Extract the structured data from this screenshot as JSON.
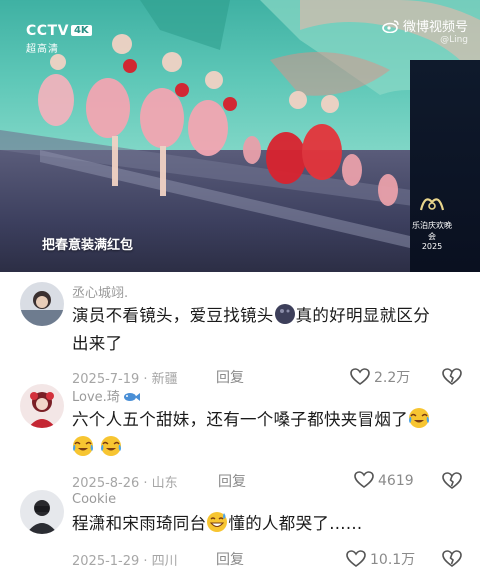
{
  "video": {
    "channel_logo": "CCTV",
    "channel_badge": "4K",
    "channel_sub": "超高清",
    "watermark": "微博视频号",
    "watermark_sub": "@Ling",
    "caption": "把春意装满红包",
    "gala_logo_text": "乐泊庆欢晚会",
    "gala_year": "2025"
  },
  "comments": [
    {
      "username": "丞心城翊.",
      "text_line1_a": "演员不看镜头，爱豆找镜头",
      "text_line1_b": "真的好明显就区分",
      "text_line2": "出来了",
      "date_location": "2025-7-19 · 新疆",
      "reply_label": "回复",
      "likes": "2.2万"
    },
    {
      "username": "Love.琦",
      "text_line1": "六个人五个甜妹，还有一个嗓子都快夹冒烟了",
      "date_location": "2025-8-26 · 山东",
      "reply_label": "回复",
      "likes": "4619"
    },
    {
      "username": "Cookie",
      "text_line1_a": "程潇和宋雨琦同台",
      "text_line1_b": "懂的人都哭了......",
      "date_location": "2025-1-29 · 四川",
      "reply_label": "回复",
      "likes": "10.1万"
    }
  ],
  "icons": [
    "weibo-logo-icon",
    "heart-icon",
    "broken-heart-icon",
    "dark-orb-emoji-icon",
    "crying-laughing-emoji-icon",
    "grin-sweat-emoji-icon",
    "fish-icon"
  ],
  "colors": {
    "text": "#1a1a1a",
    "meta": "#a6a6a6",
    "username": "#9a9a9a"
  }
}
